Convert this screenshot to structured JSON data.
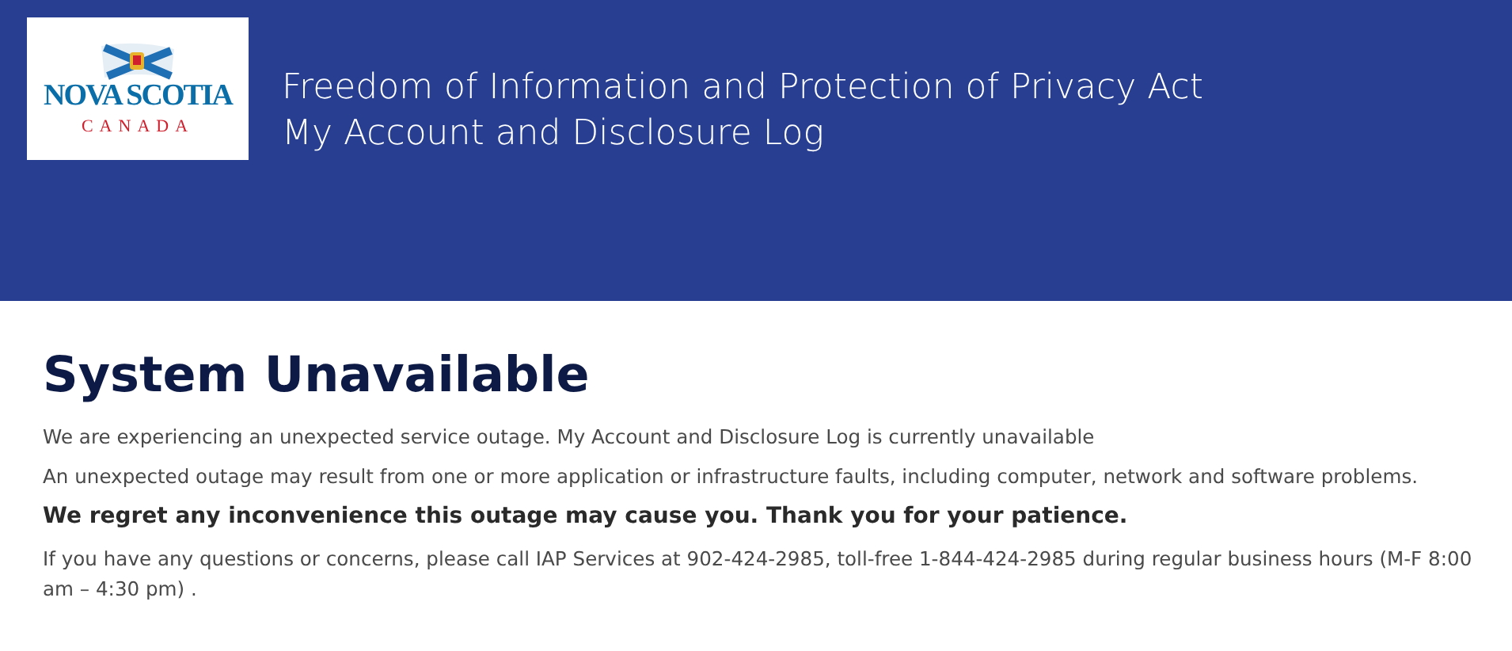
{
  "header": {
    "logo": {
      "name": "NOVA SCOTIA",
      "country": "CANADA"
    },
    "title_lines": [
      "Freedom of Information and Protection of Privacy Act",
      "My Account and Disclosure Log"
    ]
  },
  "main": {
    "heading": "System Unavailable",
    "paragraphs": [
      {
        "kind": "plain",
        "text": "We are experiencing an unexpected service outage. My Account and Disclosure Log is currently unavailable"
      },
      {
        "kind": "plain",
        "text": "An unexpected outage may result from one or more application or infrastructure faults, including computer, network and software problems."
      },
      {
        "kind": "emphasis",
        "text": "We regret any inconvenience this outage may cause you. Thank you for your patience."
      },
      {
        "kind": "plain",
        "text": "If you have any questions or concerns, please call IAP Services at 902-424-2985, toll-free 1-844-424-2985 during regular business hours (M-F 8:00 am – 4:30 pm) ."
      }
    ]
  }
}
